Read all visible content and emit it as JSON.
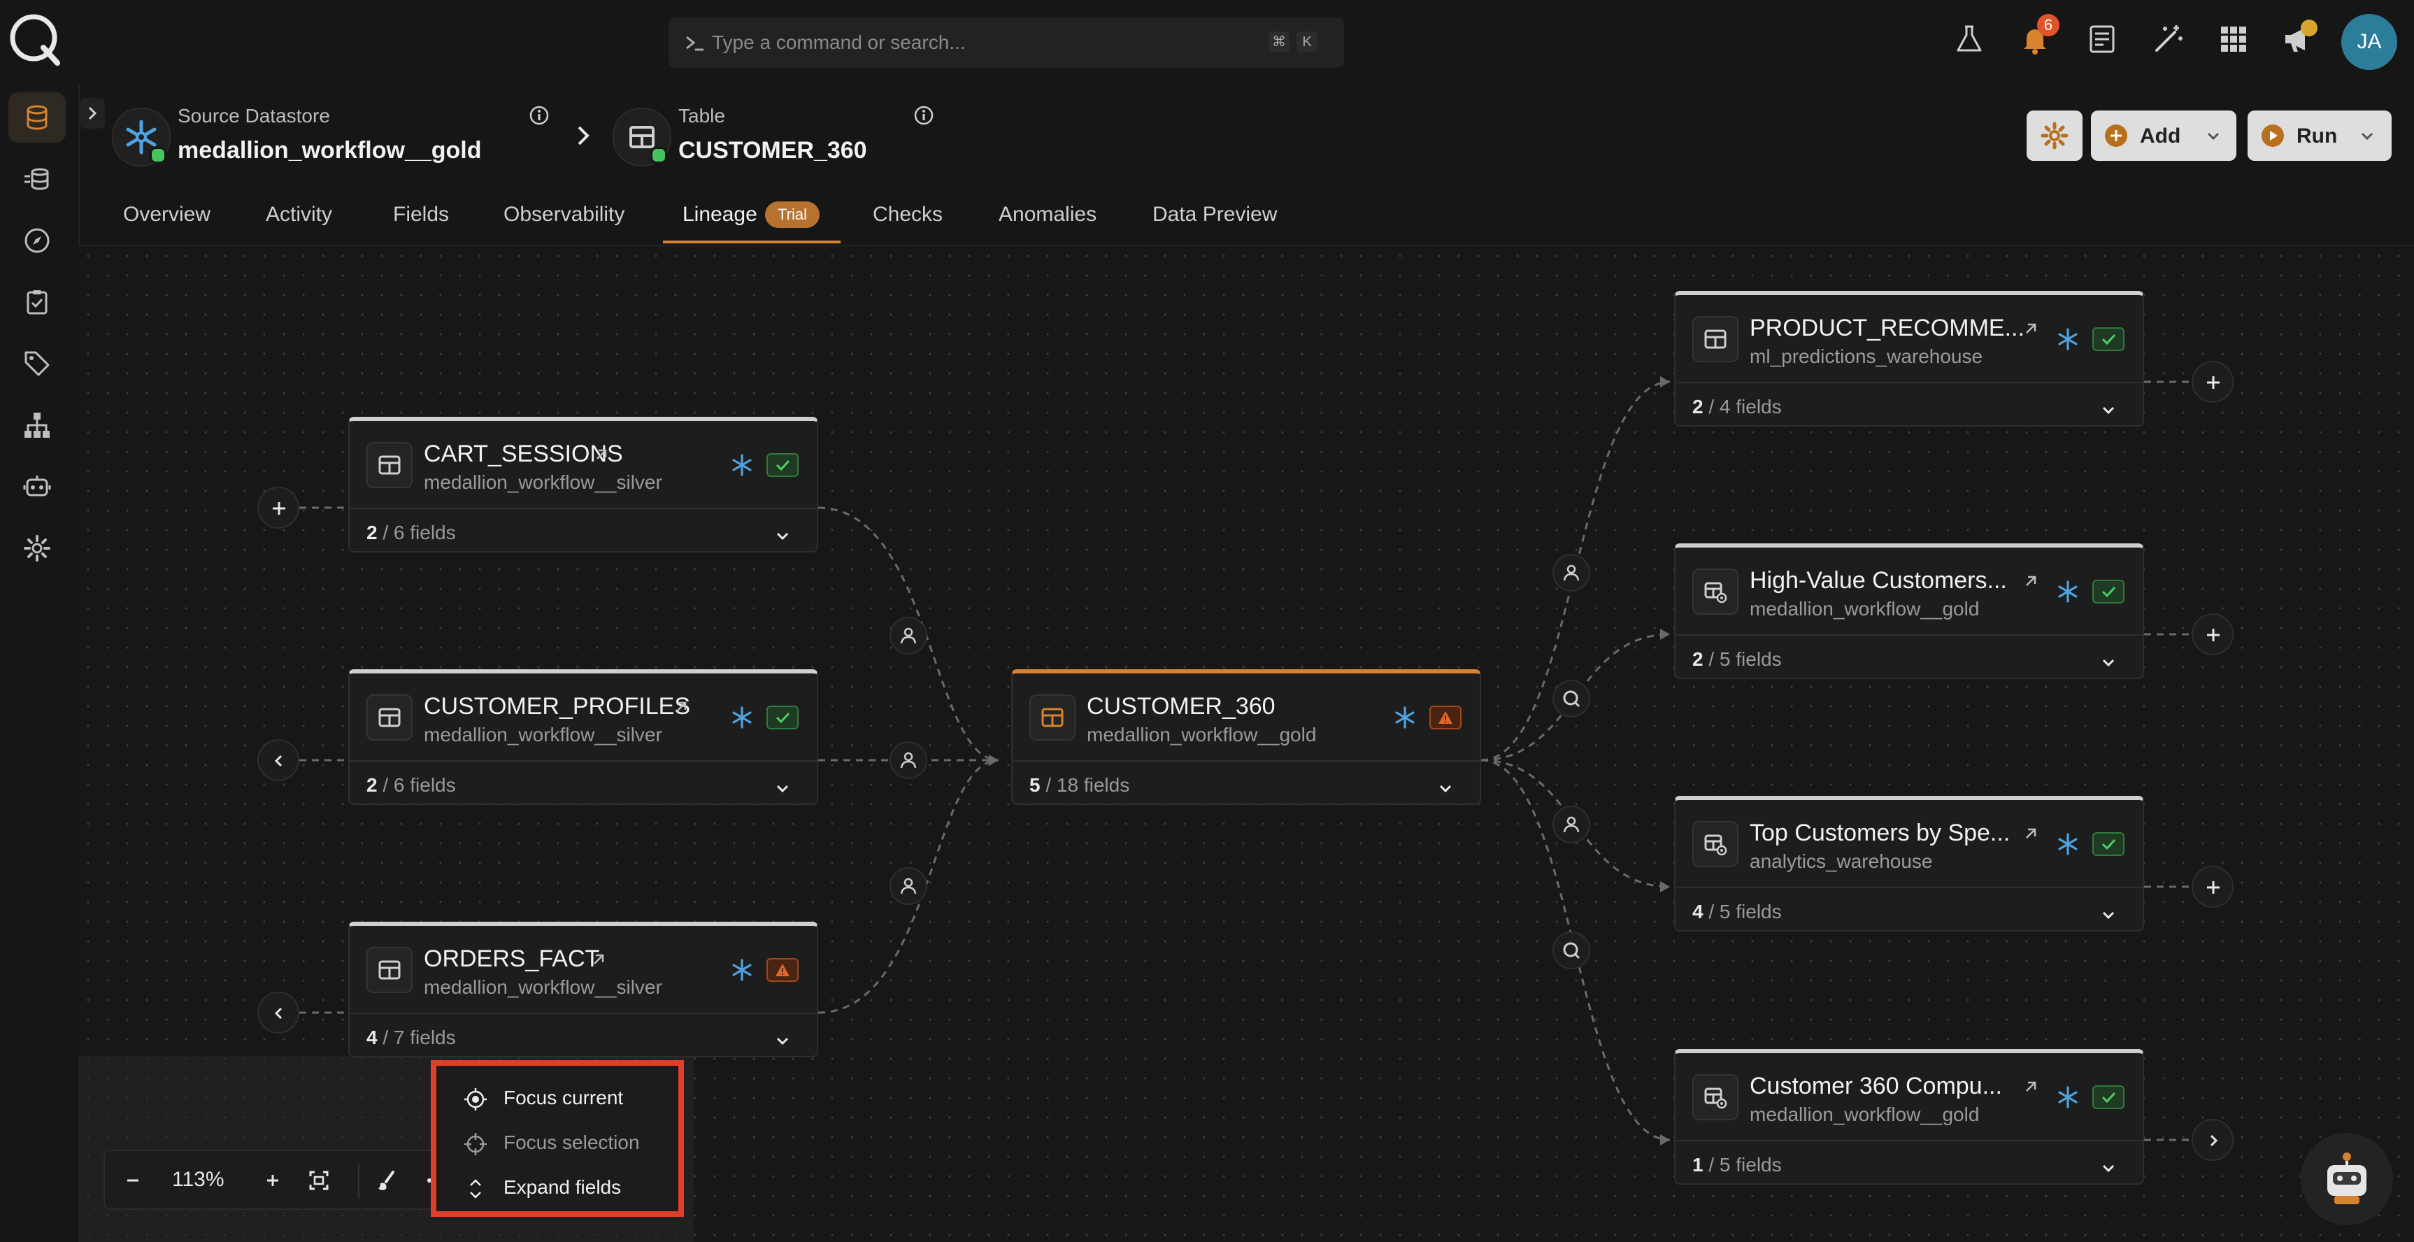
{
  "command_bar": {
    "placeholder": "Type a command or search...",
    "shortcut_keys": [
      "⌘",
      "K"
    ]
  },
  "notifications": {
    "count": "6"
  },
  "user": {
    "initials": "JA"
  },
  "sidebar": {
    "items": [
      "datastores-icon",
      "pipelines-icon",
      "explore-icon",
      "checks-icon",
      "tags-icon",
      "hierarchy-icon",
      "agent-icon",
      "settings-icon"
    ]
  },
  "breadcrumb": {
    "datastore_label": "Source Datastore",
    "datastore_name": "medallion_workflow__gold",
    "table_label": "Table",
    "table_name": "CUSTOMER_360"
  },
  "header_buttons": {
    "add": "Add",
    "run": "Run"
  },
  "tabs": [
    {
      "label": "Overview"
    },
    {
      "label": "Activity"
    },
    {
      "label": "Fields"
    },
    {
      "label": "Observability"
    },
    {
      "label": "Lineage",
      "badge": "Trial",
      "active": true
    },
    {
      "label": "Checks"
    },
    {
      "label": "Anomalies"
    },
    {
      "label": "Data Preview"
    }
  ],
  "lineage": {
    "upstream": [
      {
        "name": "CART_SESSIONS",
        "source": "medallion_workflow__silver",
        "fields_shown": "2",
        "fields_total": " / 6 fields",
        "status": "ok"
      },
      {
        "name": "CUSTOMER_PROFILES",
        "source": "medallion_workflow__silver",
        "fields_shown": "2",
        "fields_total": " / 6 fields",
        "status": "ok"
      },
      {
        "name": "ORDERS_FACT",
        "source": "medallion_workflow__silver",
        "fields_shown": "4",
        "fields_total": " / 7 fields",
        "status": "warning"
      }
    ],
    "current": {
      "name": "CUSTOMER_360",
      "source": "medallion_workflow__gold",
      "fields_shown": "5",
      "fields_total": " / 18 fields",
      "status": "warning"
    },
    "downstream": [
      {
        "name": "PRODUCT_RECOMME...",
        "source": "ml_predictions_warehouse",
        "fields_shown": "2",
        "fields_total": " / 4 fields",
        "status": "ok"
      },
      {
        "name": "High-Value Customers...",
        "source": "medallion_workflow__gold",
        "fields_shown": "2",
        "fields_total": " / 5 fields",
        "status": "ok"
      },
      {
        "name": "Top Customers by Spe...",
        "source": "analytics_warehouse",
        "fields_shown": "4",
        "fields_total": " / 5 fields",
        "status": "ok"
      },
      {
        "name": "Customer 360 Compu...",
        "source": "medallion_workflow__gold",
        "fields_shown": "1",
        "fields_total": " / 5 fields",
        "status": "ok"
      }
    ]
  },
  "zoom": {
    "level": "113%"
  },
  "context_menu": {
    "items": [
      {
        "label": "Focus current",
        "enabled": true
      },
      {
        "label": "Focus selection",
        "enabled": false
      },
      {
        "label": "Expand fields",
        "enabled": true
      }
    ]
  },
  "colors": {
    "accent": "#d8832f",
    "ok": "#2f7a3a",
    "warning": "#a3451e",
    "snowflake": "#4fa3e0",
    "highlight": "#e0402a"
  }
}
